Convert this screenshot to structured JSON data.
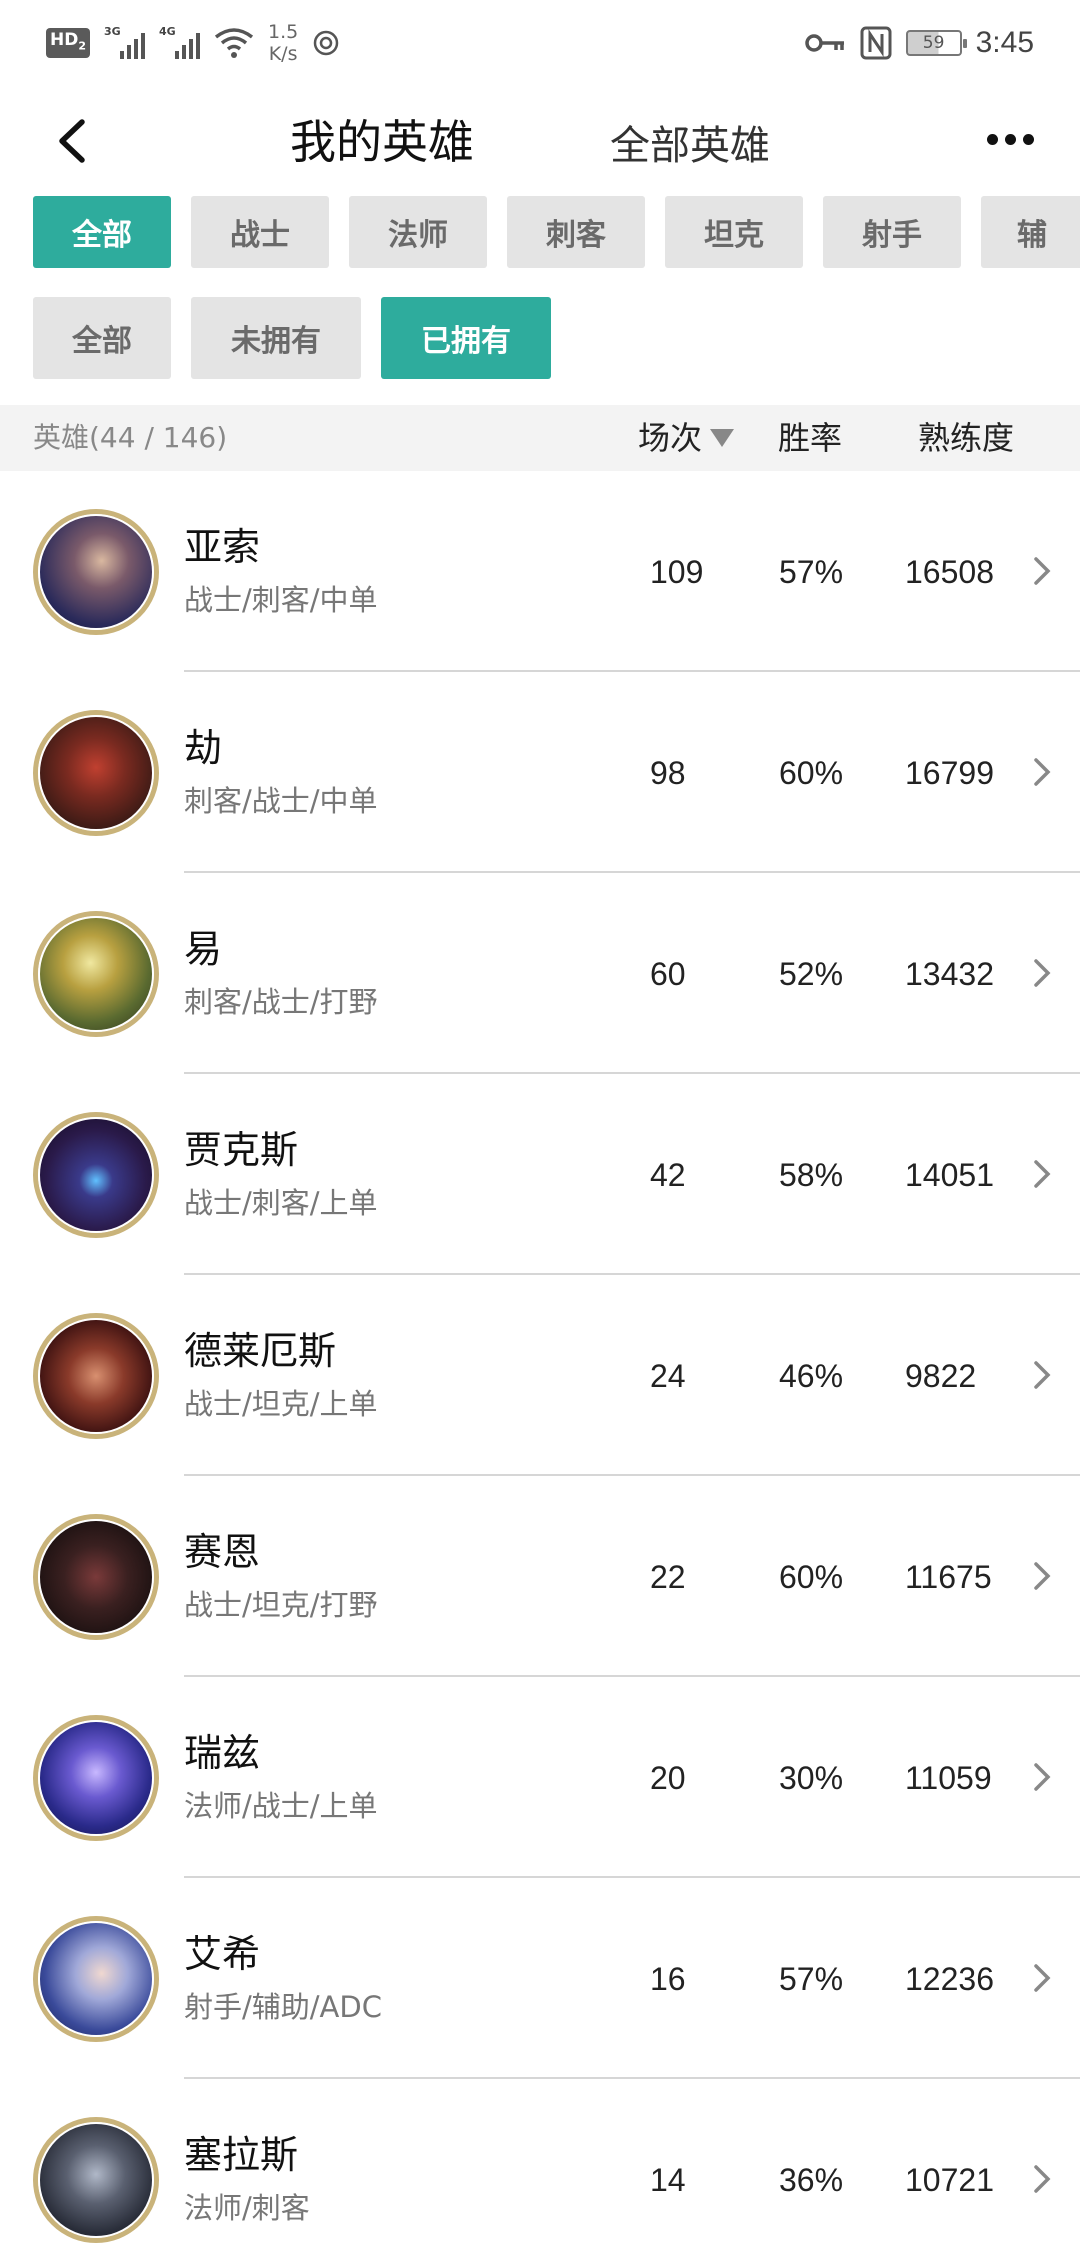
{
  "status_bar": {
    "hd": "HD",
    "sim": "2",
    "net1": "3G",
    "net2": "4G",
    "speed_value": "1.5",
    "speed_unit": "K/s",
    "battery": "59",
    "time": "3:45"
  },
  "header": {
    "tab_mine": "我的英雄",
    "tab_all": "全部英雄"
  },
  "role_filters": [
    "全部",
    "战士",
    "法师",
    "刺客",
    "坦克",
    "射手",
    "辅"
  ],
  "ownership_filters": [
    "全部",
    "未拥有",
    "已拥有"
  ],
  "table_header": {
    "count": "英雄(44 / 146)",
    "games": "场次",
    "winrate": "胜率",
    "proficiency": "熟练度"
  },
  "heroes": [
    {
      "name": "亚索",
      "roles": "战士/刺客/中单",
      "games": "109",
      "winrate": "57%",
      "proficiency": "16508"
    },
    {
      "name": "劫",
      "roles": "刺客/战士/中单",
      "games": "98",
      "winrate": "60%",
      "proficiency": "16799"
    },
    {
      "name": "易",
      "roles": "刺客/战士/打野",
      "games": "60",
      "winrate": "52%",
      "proficiency": "13432"
    },
    {
      "name": "贾克斯",
      "roles": "战士/刺客/上单",
      "games": "42",
      "winrate": "58%",
      "proficiency": "14051"
    },
    {
      "name": "德莱厄斯",
      "roles": "战士/坦克/上单",
      "games": "24",
      "winrate": "46%",
      "proficiency": "9822"
    },
    {
      "name": "赛恩",
      "roles": "战士/坦克/打野",
      "games": "22",
      "winrate": "60%",
      "proficiency": "11675"
    },
    {
      "name": "瑞兹",
      "roles": "法师/战士/上单",
      "games": "20",
      "winrate": "30%",
      "proficiency": "11059"
    },
    {
      "name": "艾希",
      "roles": "射手/辅助/ADC",
      "games": "16",
      "winrate": "57%",
      "proficiency": "12236"
    },
    {
      "name": "塞拉斯",
      "roles": "法师/刺客",
      "games": "14",
      "winrate": "36%",
      "proficiency": "10721"
    }
  ],
  "colors": {
    "accent": "#2eac9d",
    "chip_inactive": "#e4e4e4",
    "avatar_ring": "#c9b37a"
  }
}
